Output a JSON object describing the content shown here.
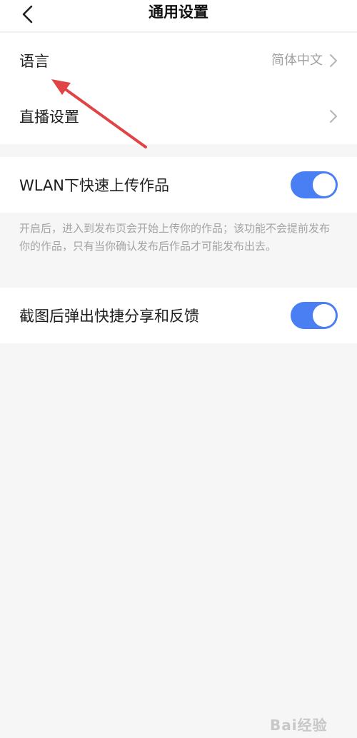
{
  "header": {
    "title": "通用设置",
    "back_icon": "chevron-left-icon"
  },
  "group1": {
    "items": [
      {
        "label": "语言",
        "value": "简体中文",
        "icon": "chevron-right-icon"
      },
      {
        "label": "直播设置",
        "value": "",
        "icon": "chevron-right-icon"
      }
    ]
  },
  "wlan": {
    "label": "WLAN下快速上传作品",
    "enabled": true,
    "note": "开启后，进入到发布页会开始上传你的作品；该功能不会提前发布你的作品，只有当你确认发布后作品才可能发布出去。"
  },
  "screenshot_share": {
    "label": "截图后弹出快捷分享和反馈",
    "enabled": true
  },
  "colors": {
    "accent": "#4a7ff4",
    "annotation_arrow": "#e04444",
    "background": "#f6f6f6"
  },
  "watermark": {
    "text": "Bai经验"
  }
}
